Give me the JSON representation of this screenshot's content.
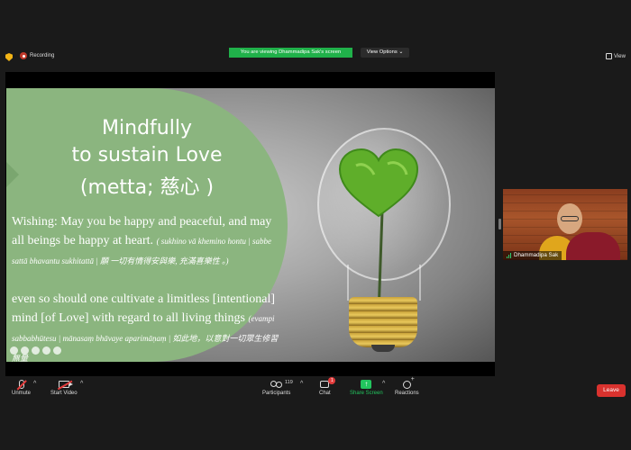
{
  "top_bar": {
    "recording_label": "Recording",
    "viewing_banner": "You are viewing Dhammadipa Sak's screen",
    "view_options_label": "View Options",
    "view_options_caret": "⌄",
    "view_label": "View"
  },
  "slide": {
    "title_lines": [
      "Mindfully",
      "to sustain Love",
      "(metta; 慈心 )"
    ],
    "paragraph1_main": "Wishing: May you be happy and peaceful,  and may all beings be happy at heart.",
    "paragraph1_note": "( sukhino vā khemino hontu | sabbe sattā bhavantu sukhitattā | 願 一切有情得安與樂, 充滿喜樂性 。)",
    "paragraph2_main": "even so should one cultivate a limitless [intentional] mind [of Love] with regard to all living things",
    "paragraph2_note": "(evampi sabbabhūtesu | mānasaṃ bhāvaye aparimāṇaṃ | 如此地，以意對一切眾生修習無量"
  },
  "participant": {
    "name": "Dhammadipa Sak"
  },
  "toolbar": {
    "unmute_label": "Unmute",
    "video_label": "Start Video",
    "participants_label": "Participants",
    "participants_count": "119",
    "chat_label": "Chat",
    "chat_badge": "1",
    "share_label": "Share Screen",
    "reactions_label": "Reactions",
    "leave_label": "Leave",
    "caret": "^"
  },
  "colors": {
    "slide_green": "#8bb57f",
    "share_green": "#22c55e",
    "leave_red": "#d9322e",
    "recording_red": "#c0392b"
  },
  "icons": [
    "shield-icon",
    "recording-icon",
    "view-grid-icon",
    "mic-muted-icon",
    "camera-off-icon",
    "participants-icon",
    "chat-icon",
    "share-screen-icon",
    "reactions-icon",
    "signal-icon"
  ]
}
